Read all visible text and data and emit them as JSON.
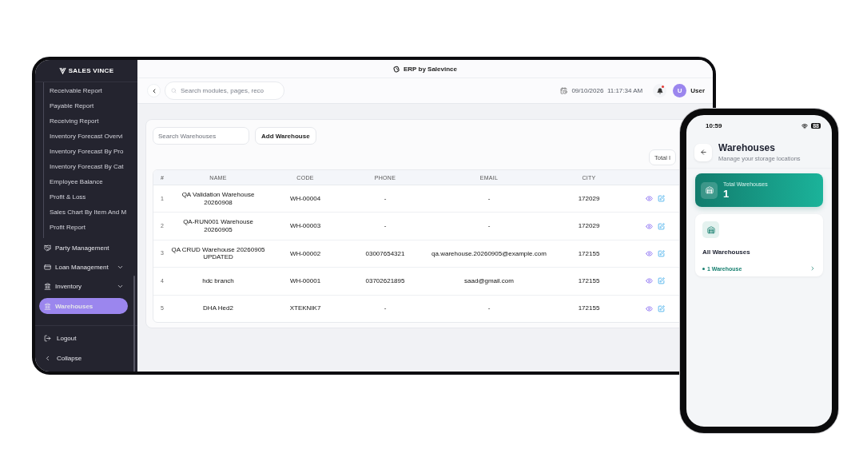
{
  "tablet": {
    "title": "ERP by Salevince",
    "sidebar": {
      "logo": "SALES VINCE",
      "report_items": [
        "Receivable Report",
        "Payable Report",
        "Receiving Report",
        "Inventory Forecast Overvi",
        "Inventory Forecast By Pro",
        "Inventory Forecast By Cat",
        "Employee Balance",
        "Profit & Loss",
        "Sales Chart By Item And M",
        "Profit Report"
      ],
      "nav_items": [
        {
          "label": "Party Management",
          "expandable": false,
          "selected": false
        },
        {
          "label": "Loan Management",
          "expandable": true,
          "selected": false
        },
        {
          "label": "Inventory",
          "expandable": true,
          "selected": false
        },
        {
          "label": "Warehouses",
          "expandable": false,
          "selected": true
        }
      ],
      "footer_items": [
        "Logout",
        "Collapse"
      ]
    },
    "header": {
      "search_placeholder": "Search modules, pages, reco",
      "date": "09/10/2026",
      "time": "11:17:34 AM",
      "notification_unread": true,
      "avatar": "U",
      "user": "User"
    },
    "toolbar": {
      "search_placeholder": "Search Warehouses",
      "add_button": "Add Warehouse",
      "total": "Total I"
    },
    "table": {
      "columns": [
        "#",
        "NAME",
        "CODE",
        "PHONE",
        "EMAIL",
        "CITY"
      ],
      "rows": [
        [
          "1",
          "QA Validation Warehouse 20260908",
          "WH-00004",
          "-",
          "-",
          "172029"
        ],
        [
          "2",
          "QA-RUN001 Warehouse 20260905",
          "WH-00003",
          "-",
          "-",
          "172029"
        ],
        [
          "3",
          "QA CRUD Warehouse 20260905 UPDATED",
          "WH-00002",
          "03007654321",
          "qa.warehouse.20260905@example.com",
          "172155"
        ],
        [
          "4",
          "hdc branch",
          "WH-00001",
          "03702621895",
          "saad@gmail.com",
          "172155"
        ],
        [
          "5",
          "DHA Hed2",
          "XTEKNIK7",
          "-",
          "-",
          "172155"
        ]
      ]
    }
  },
  "phone": {
    "time": "10:59",
    "battery": "88",
    "title": "Warehouses",
    "subtitle": "Manage your storage locations",
    "total_label": "Total Warehouses",
    "total_value": "1",
    "card_title": "All Warehouses",
    "card_count": "1 Warehouse"
  }
}
